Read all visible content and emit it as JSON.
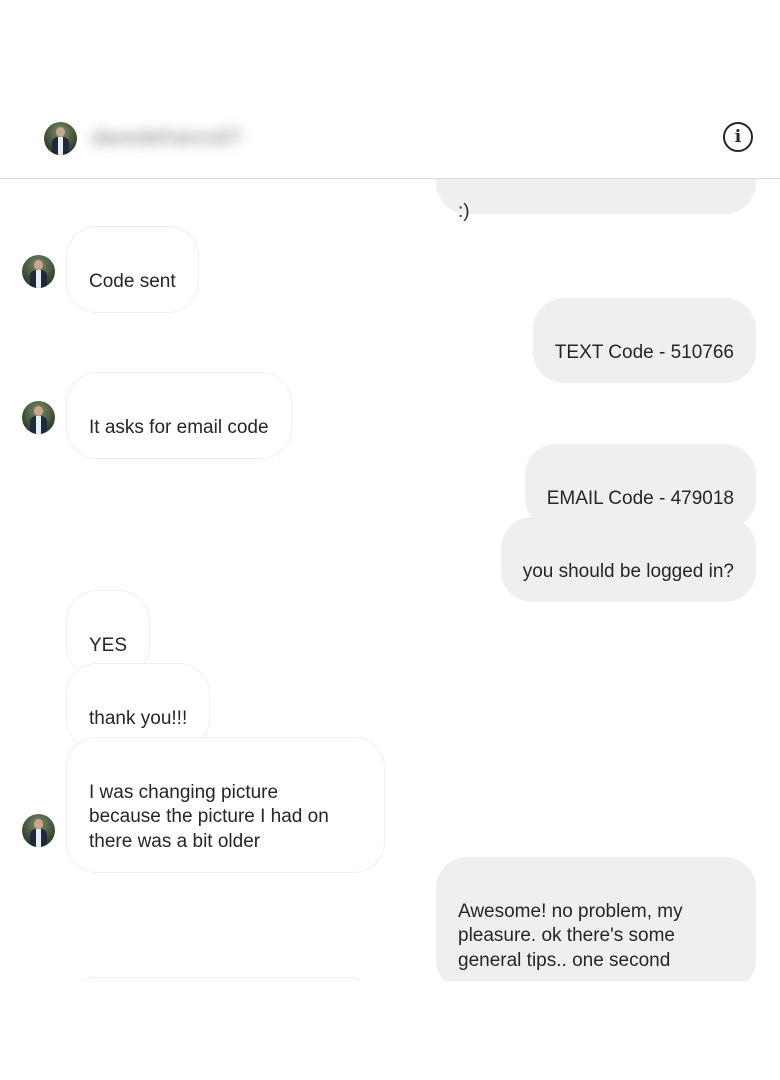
{
  "header": {
    "username": "davedefranco07",
    "info_icon": "info-icon",
    "info_glyph": "i"
  },
  "messages": [
    {
      "side": "out",
      "text": ":)"
    },
    {
      "side": "in",
      "text": "Code sent"
    },
    {
      "side": "out",
      "text": "TEXT Code - 510766"
    },
    {
      "side": "in",
      "text": "It asks for email code"
    },
    {
      "side": "out",
      "text": "EMAIL Code - 479018"
    },
    {
      "side": "out",
      "text": "you should be logged in?"
    },
    {
      "side": "in",
      "text": "YES"
    },
    {
      "side": "in",
      "text": "thank you!!!"
    },
    {
      "side": "in",
      "text": "I was changing picture\nbecause the picture I had on\nthere was a bit older"
    },
    {
      "side": "out",
      "text": "Awesome! no problem, my\npleasure. ok there's some\ngeneral tips.. one second"
    }
  ]
}
